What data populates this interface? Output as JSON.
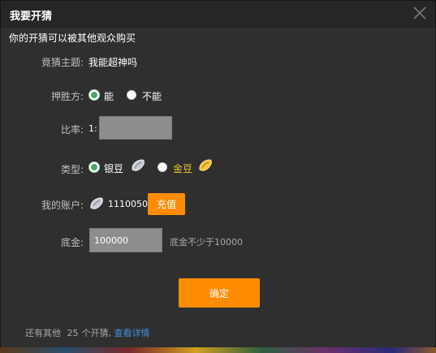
{
  "dialog": {
    "title": "我要开猜",
    "subtitle": "你的开猜可以被其他观众购买"
  },
  "topic": {
    "label": "竟猜主题:",
    "value": "我能超神吗"
  },
  "winner": {
    "label": "押胜方:",
    "options": [
      {
        "label": "能",
        "checked": true
      },
      {
        "label": "不能",
        "checked": false
      }
    ]
  },
  "ratio": {
    "label": "比率:",
    "prefix": "1:",
    "value": ""
  },
  "type": {
    "label": "类型:",
    "options": [
      {
        "label": "银豆",
        "checked": true,
        "color": "#ffffff",
        "icon": "silver-bean-icon"
      },
      {
        "label": "金豆",
        "checked": false,
        "color": "#f0c030",
        "icon": "gold-bean-icon"
      }
    ]
  },
  "account": {
    "label": "我的账户:",
    "icon": "silver-bean-icon",
    "balance": "1110050",
    "recharge_label": "充值"
  },
  "deposit": {
    "label": "底金:",
    "value": "100000",
    "hint": "底金不少于10000"
  },
  "confirm_label": "确定",
  "footer": {
    "prefix": "还有其他",
    "count": "25",
    "suffix": "个开猜,",
    "link": "查看详情"
  },
  "colors": {
    "accent": "#ff8c00",
    "radio_checked": "#4fa36c",
    "gold_text": "#f0c030",
    "link": "#3d8fe0"
  }
}
